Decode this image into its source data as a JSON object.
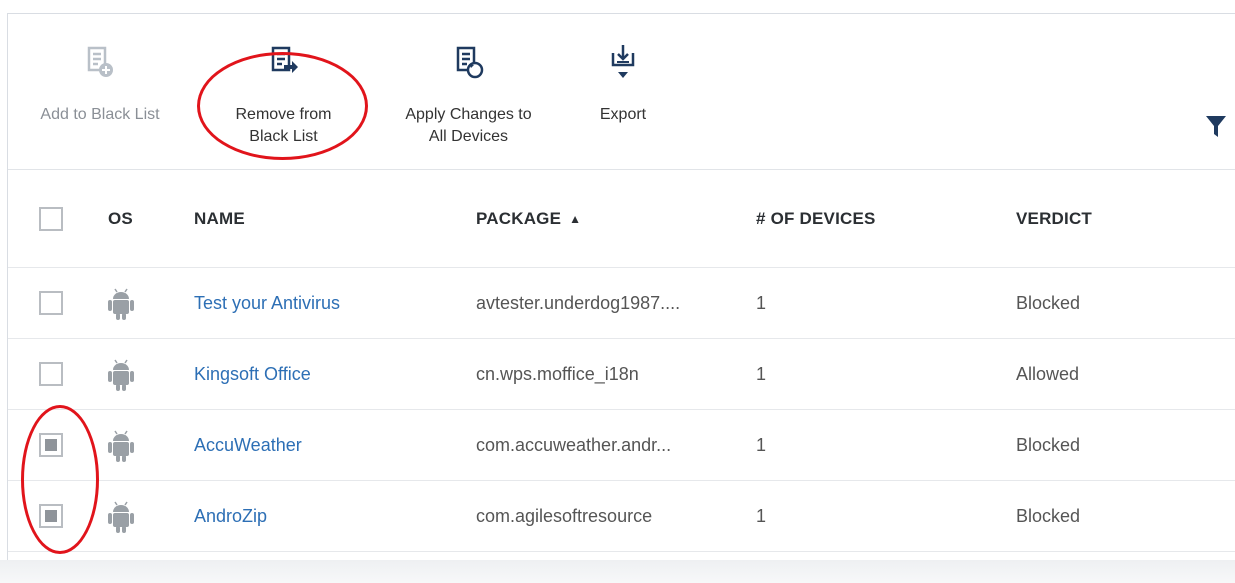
{
  "toolbar": {
    "add_label": "Add to Black List",
    "remove_label": "Remove from\nBlack List",
    "apply_label": "Apply Changes to\nAll Devices",
    "export_label": "Export"
  },
  "table": {
    "headers": {
      "os": "OS",
      "name": "NAME",
      "package": "PACKAGE",
      "sort_indicator": "▲",
      "devices": "# OF DEVICES",
      "verdict": "VERDICT"
    },
    "rows": [
      {
        "name": "Test your Antivirus",
        "package": "avtester.underdog1987....",
        "devices": "1",
        "verdict": "Blocked",
        "checked": false
      },
      {
        "name": "Kingsoft Office",
        "package": "cn.wps.moffice_i18n",
        "devices": "1",
        "verdict": "Allowed",
        "checked": false
      },
      {
        "name": "AccuWeather",
        "package": "com.accuweather.andr...",
        "devices": "1",
        "verdict": "Blocked",
        "checked": true
      },
      {
        "name": "AndroZip",
        "package": "com.agilesoftresource",
        "devices": "1",
        "verdict": "Blocked",
        "checked": true
      }
    ]
  },
  "colors": {
    "link": "#2d6fb5",
    "icon": "#1f3a5f",
    "annotation": "#e1141b",
    "android": "#9aa0a6"
  },
  "icons": {
    "add": "document-plus-icon",
    "remove": "document-arrow-icon",
    "apply": "document-refresh-icon",
    "export": "download-tray-icon",
    "filter": "funnel-icon",
    "os": "android-icon"
  }
}
